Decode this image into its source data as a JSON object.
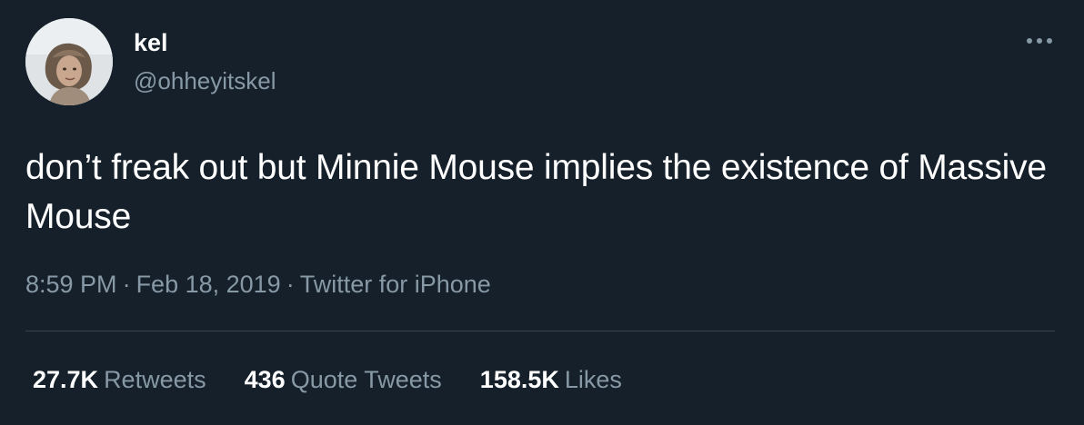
{
  "author": {
    "display_name": "kel",
    "handle": "@ohheyitskel"
  },
  "more_icon": "more-horizontal-icon",
  "tweet": {
    "text": "don’t freak out but Minnie Mouse implies the existence of Massive Mouse",
    "time": "8:59 PM",
    "date": "Feb 18, 2019",
    "separator": "·",
    "source": "Twitter for iPhone"
  },
  "stats": {
    "retweets": {
      "count": "27.7K",
      "label": "Retweets"
    },
    "quote_tweets": {
      "count": "436",
      "label": "Quote Tweets"
    },
    "likes": {
      "count": "158.5K",
      "label": "Likes"
    }
  },
  "colors": {
    "background": "#15202b",
    "primary_text": "#ffffff",
    "secondary_text": "#8899a6",
    "divider": "#38444d"
  }
}
